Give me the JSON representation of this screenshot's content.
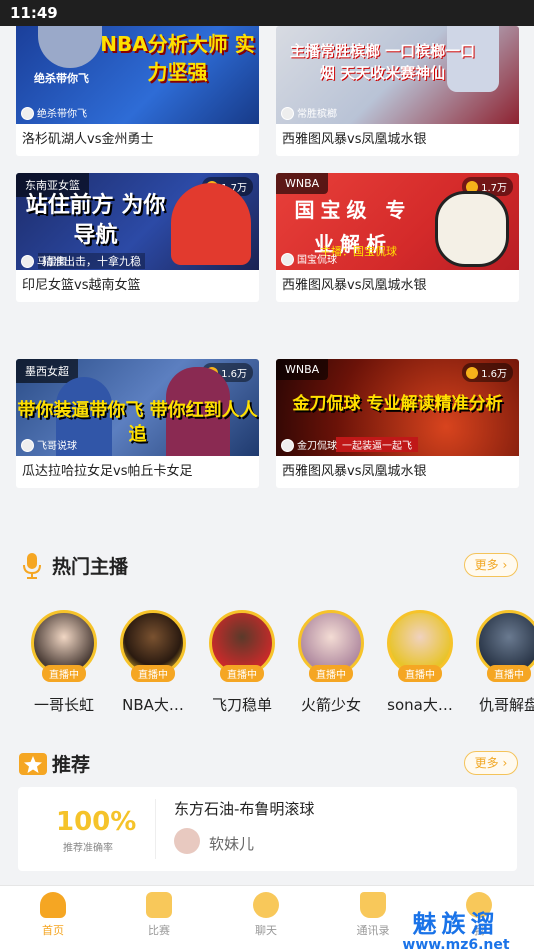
{
  "status_bar": {
    "time": "11:49"
  },
  "colors": {
    "accent": "#f5a623",
    "live_badge": "#f5a623",
    "more_border": "#f4c35a"
  },
  "matches": [
    {
      "tag": "",
      "views": "",
      "host": "绝杀带你飞",
      "headline": "NBA分析大师 实力坚强",
      "caption": "洛杉矶湖人vs金州勇士"
    },
    {
      "tag": "",
      "views": "",
      "host": "常胜槟榔",
      "headline": "主播常胜槟榔 一口槟榔一口烟 天天收米赛神仙",
      "caption": "西雅图风暴vs凤凰城水银"
    },
    {
      "tag": "东南亚女篮",
      "views": "1.7万",
      "host": "马里奥",
      "headline": "站住前方 为你导航",
      "sub": "精准出击，十拿九稳",
      "caption": "印尼女篮vs越南女篮"
    },
    {
      "tag": "WNBA",
      "views": "1.7万",
      "host": "国宝侃球",
      "headline": "国宝级 专业解析",
      "sub": "主播：国宝侃球",
      "caption": "西雅图风暴vs凤凰城水银"
    },
    {
      "tag": "墨西女超",
      "views": "1.6万",
      "host": "飞哥说球",
      "headline": "带你装逼带你飞 带你红到人人追",
      "caption": "瓜达拉哈拉女足vs帕丘卡女足"
    },
    {
      "tag": "WNBA",
      "views": "1.6万",
      "host": "金刀侃球",
      "headline": "金刀侃球 专业解读精准分析",
      "sub": "一起装逼一起飞",
      "caption": "西雅图风暴vs凤凰城水银"
    }
  ],
  "hot_hosts": {
    "title": "热门主播",
    "more": "更多",
    "live_label": "直播中",
    "items": [
      {
        "name": "一哥长虹"
      },
      {
        "name": "NBA大…"
      },
      {
        "name": "飞刀稳单"
      },
      {
        "name": "火箭少女"
      },
      {
        "name": "sona大…"
      },
      {
        "name": "仇哥解盘"
      }
    ]
  },
  "recommend": {
    "title": "推荐",
    "more": "更多",
    "accuracy": "100%",
    "accuracy_label": "推荐准确率",
    "match": "东方石油-布鲁明滚球",
    "author": "软妹儿"
  },
  "tabbar": [
    {
      "label": "首页",
      "icon": "home-icon",
      "active": true
    },
    {
      "label": "比赛",
      "icon": "match-icon",
      "active": false
    },
    {
      "label": "聊天",
      "icon": "chat-icon",
      "active": false
    },
    {
      "label": "通讯录",
      "icon": "contacts-icon",
      "active": false
    },
    {
      "label": "我",
      "icon": "profile-icon",
      "active": false
    }
  ],
  "watermark": {
    "text": "魅族溜",
    "url": "www.mz6.net"
  }
}
